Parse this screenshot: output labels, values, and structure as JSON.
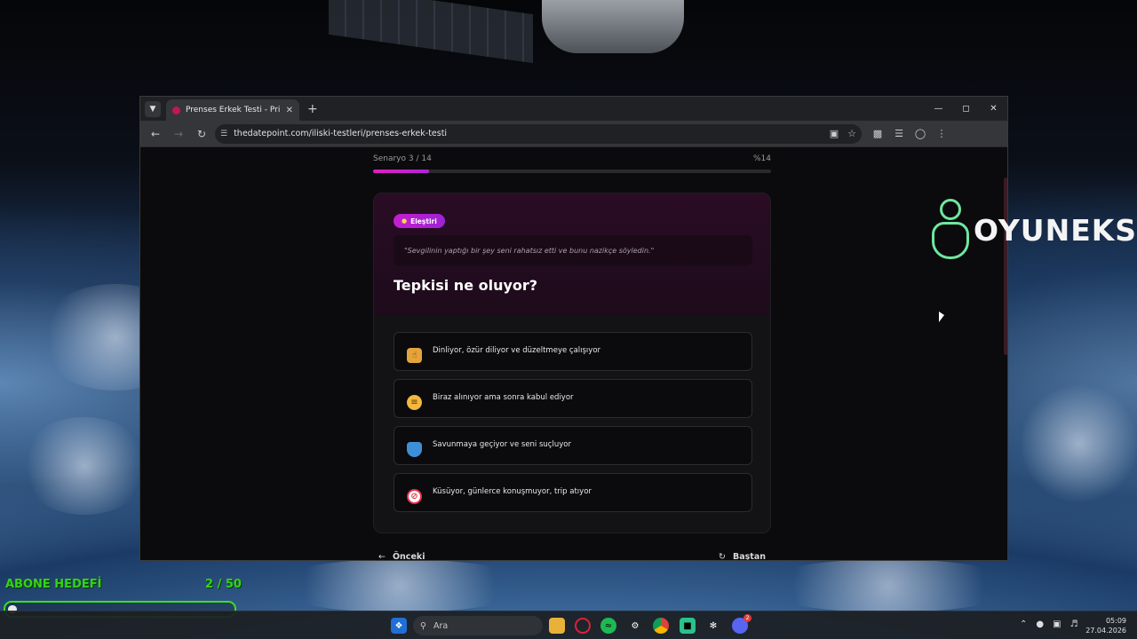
{
  "browser": {
    "tab_title": "Prenses Erkek Testi - Princess M",
    "url": "thedatepoint.com/iliski-testleri/prenses-erkek-testi"
  },
  "quiz": {
    "scenario_label": "Senaryo 3 / 14",
    "percent_label": "%14",
    "progress": 0.14,
    "badge": "Eleştiri",
    "quote": "\"Sevgilinin yaptığı bir şey seni rahatsız etti ve bunu nazikçe söyledin.\"",
    "question": "Tepkisi ne oluyor?",
    "options": [
      {
        "icon": "thumbs-up-icon",
        "text": "Dinliyor, özür diliyor ve düzeltmeye çalışıyor"
      },
      {
        "icon": "grimace-face-icon",
        "text": "Biraz alınıyor ama sonra kabul ediyor"
      },
      {
        "icon": "shield-icon",
        "text": "Savunmaya geçiyor ve seni suçluyor"
      },
      {
        "icon": "prohibited-icon",
        "text": "Küsüyor, günlerce konuşmuyor, trip atıyor"
      }
    ],
    "prev_label": "Önceki",
    "restart_label": "Baştan"
  },
  "watermark": {
    "text": "OYUNEKS"
  },
  "goal": {
    "label": "ABONE HEDEFİ",
    "count": "2 / 50",
    "progress": 0.04
  },
  "taskbar": {
    "search_placeholder": "Ara",
    "discord_badge": "2",
    "time": "05:09",
    "date": "27.04.2026"
  },
  "colors": {
    "accent": "#d41fcf",
    "goal_green": "#34d318"
  }
}
